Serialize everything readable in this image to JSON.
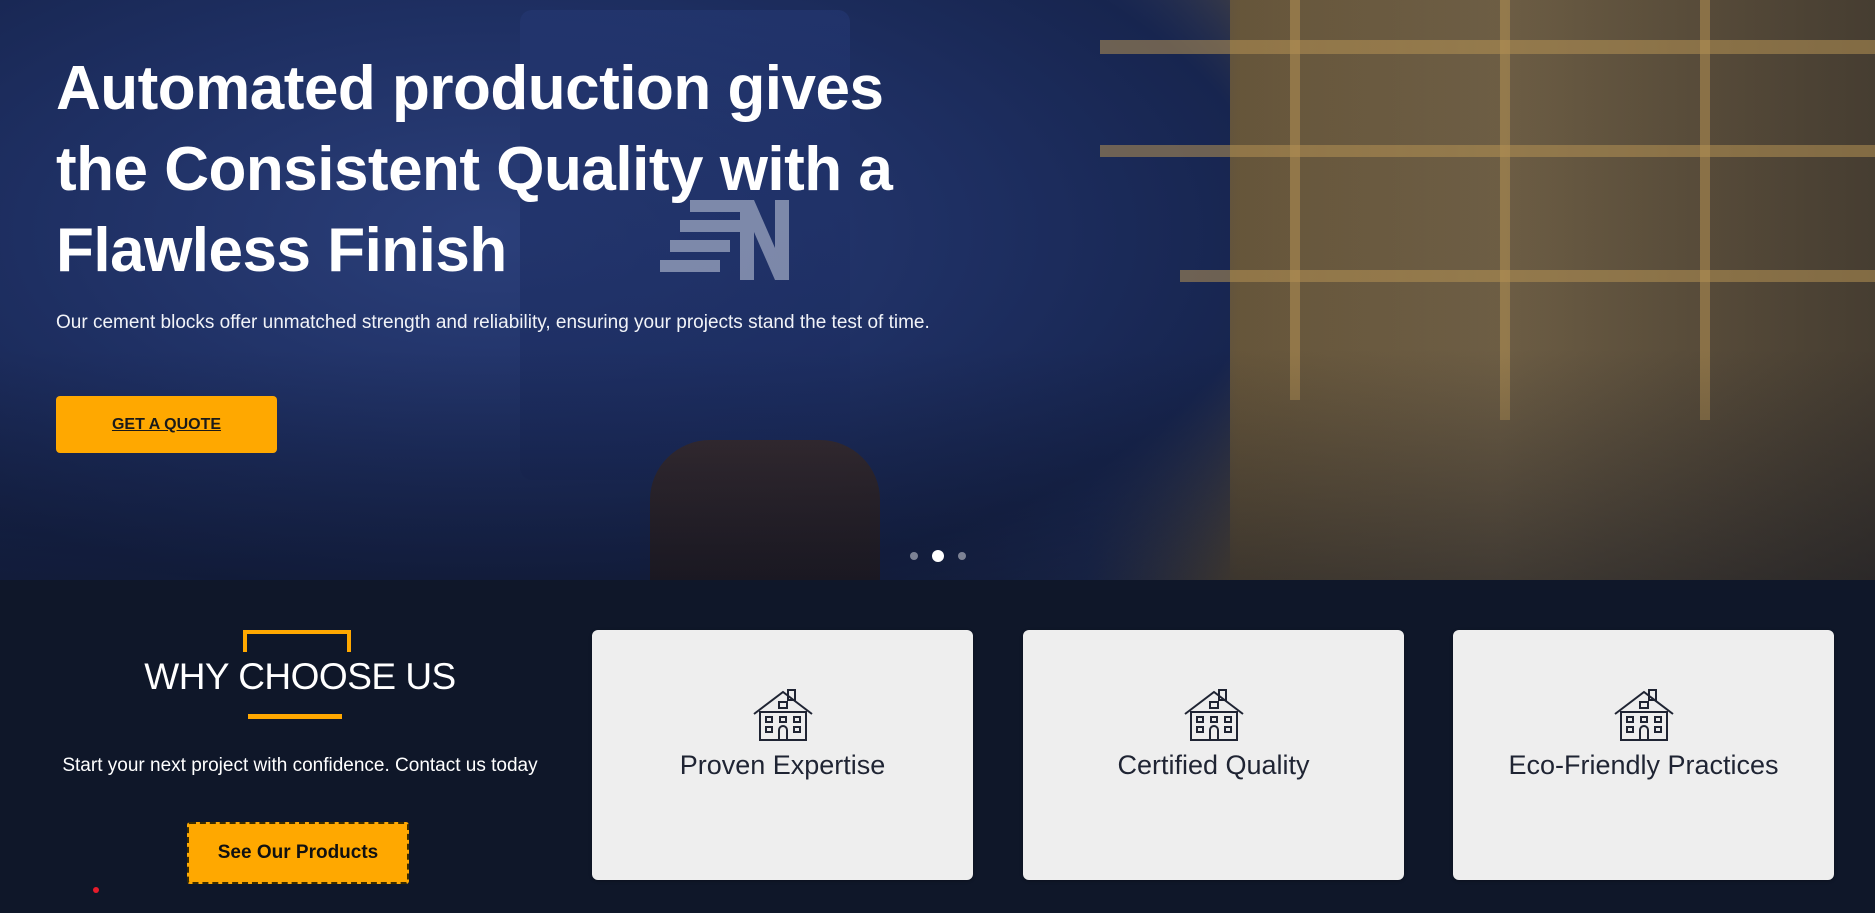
{
  "hero": {
    "title": "Automated production gives the Consistent Quality with a Flawless Finish",
    "subtitle": "Our cement blocks offer unmatched strength and reliability, ensuring your projects stand the test of time.",
    "cta_label": "GET A QUOTE",
    "slides": {
      "count": 3,
      "active_index": 1
    }
  },
  "why": {
    "title": "WHY CHOOSE US",
    "text": "Start your next project with confidence. Contact us today",
    "button_label": "See Our Products",
    "cards": [
      {
        "icon": "building-icon",
        "label": "Proven Expertise"
      },
      {
        "icon": "building-icon",
        "label": "Certified Quality"
      },
      {
        "icon": "building-icon",
        "label": "Eco-Friendly Practices"
      }
    ]
  },
  "colors": {
    "accent": "#ffa800",
    "dark_bg": "#0f1729",
    "card_bg": "#eeeeee"
  }
}
